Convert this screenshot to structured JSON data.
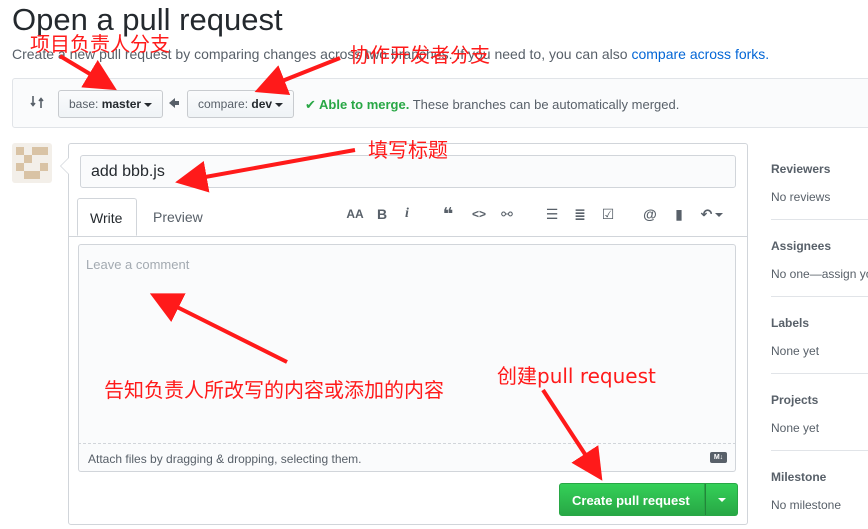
{
  "header": {
    "title": "Open a pull request",
    "subtitle_prefix": "Create a new pull request by comparing changes across two branches. If you need to, you can also ",
    "subtitle_link": "compare across forks."
  },
  "range": {
    "base_prefix": "base: ",
    "base_branch": "master",
    "compare_prefix": "compare: ",
    "compare_branch": "dev",
    "merge_ok": "Able to merge.",
    "merge_detail": " These branches can be automatically merged."
  },
  "composer": {
    "title_value": "add bbb.js",
    "tabs": {
      "write": "Write",
      "preview": "Preview"
    },
    "toolbar": {
      "header": "AA",
      "bold": "B",
      "italic": "i",
      "quote": "❝",
      "code": "<>",
      "link": "⚯",
      "bullet_list": "☰",
      "numbered_list": "≣",
      "task_list": "☑",
      "mention": "@",
      "saved_reply": "▮",
      "reply": "↶"
    },
    "placeholder": "Leave a comment",
    "attach_text": "Attach files by dragging & dropping, selecting them.",
    "markdown_badge": "M↓",
    "submit_label": "Create pull request"
  },
  "sidebar": [
    {
      "heading": "Reviewers",
      "value": "No reviews"
    },
    {
      "heading": "Assignees",
      "value": "No one—assign yourself"
    },
    {
      "heading": "Labels",
      "value": "None yet"
    },
    {
      "heading": "Projects",
      "value": "None yet"
    },
    {
      "heading": "Milestone",
      "value": "No milestone"
    }
  ],
  "annotations": {
    "base_note": "项目负责人分支",
    "compare_note": "协作开发者分支",
    "title_note": "填写标题",
    "comment_note": "告知负责人所改写的内容或添加的内容",
    "submit_note": "创建pull request"
  },
  "colors": {
    "accent_link": "#0366d6",
    "merge_green": "#28a745",
    "button_green": "#2ea44f",
    "annotation_red": "#ff1a1a"
  }
}
